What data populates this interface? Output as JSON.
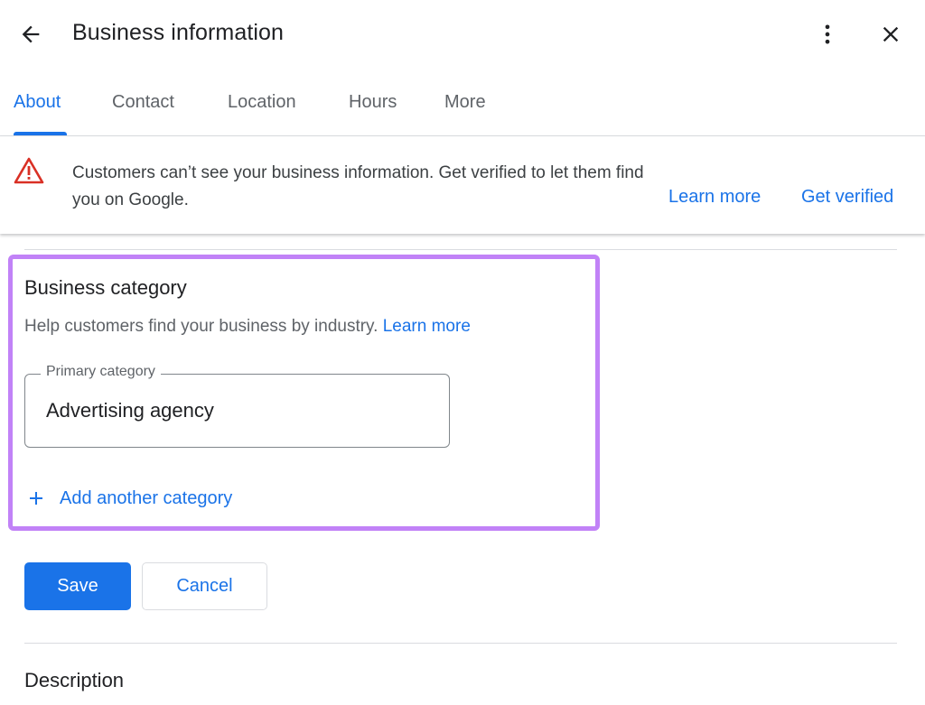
{
  "header": {
    "title": "Business information",
    "back_icon": "arrow-back-icon",
    "menu_icon": "more-vert-icon",
    "close_icon": "close-icon"
  },
  "tabs": [
    {
      "label": "About",
      "active": true
    },
    {
      "label": "Contact",
      "active": false
    },
    {
      "label": "Location",
      "active": false
    },
    {
      "label": "Hours",
      "active": false
    },
    {
      "label": "More",
      "active": false
    }
  ],
  "banner": {
    "icon": "warning-icon",
    "message": "Customers can’t see your business information. Get verified to let them find you on Google.",
    "learn_more": "Learn more",
    "get_verified": "Get verified"
  },
  "category_section": {
    "title": "Business category",
    "help_text": "Help customers find your business by industry.",
    "help_link": "Learn more",
    "primary_label": "Primary category",
    "primary_value": "Advertising agency",
    "add_label": "Add another category"
  },
  "actions": {
    "save_label": "Save",
    "cancel_label": "Cancel"
  },
  "description_section": {
    "title": "Description"
  },
  "colors": {
    "accent": "#1a73e8",
    "highlight": "#c182f7",
    "warning": "#d93025"
  }
}
